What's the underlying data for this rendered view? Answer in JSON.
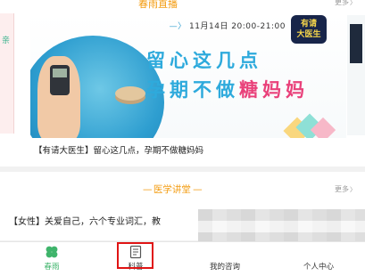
{
  "live_section": {
    "title": "春雨直播",
    "more_label": "更多",
    "banner": {
      "time_text": "11月14日 20:00-21:00",
      "headline_line1": "留心这几点",
      "headline_line2_prefix": "孕期不做",
      "headline_line2_highlight": "糖妈妈",
      "badge_line1": "有请",
      "badge_line2": "大医生",
      "caption": "【有请大医生】留心这几点，孕期不做糖妈妈"
    },
    "left_card_text": "亲"
  },
  "lecture_section": {
    "title": "医学讲堂",
    "more_label": "更多",
    "item_text": "【女性】关爱自己，六个专业词汇，教"
  },
  "bottom_nav": {
    "items": [
      {
        "label": "春雨",
        "icon": "clover-icon",
        "active": true
      },
      {
        "label": "科普",
        "icon": "document-icon",
        "active": false
      },
      {
        "label": "我的咨询",
        "icon": "chat-icon",
        "active": false
      },
      {
        "label": "个人中心",
        "icon": "person-icon",
        "active": false
      }
    ]
  },
  "colors": {
    "accent_orange": "#f39c12",
    "brand_green": "#3fb46b",
    "highlight_red": "#e01414",
    "headline_blue": "#2eaadc",
    "headline_pink": "#e9417a"
  }
}
